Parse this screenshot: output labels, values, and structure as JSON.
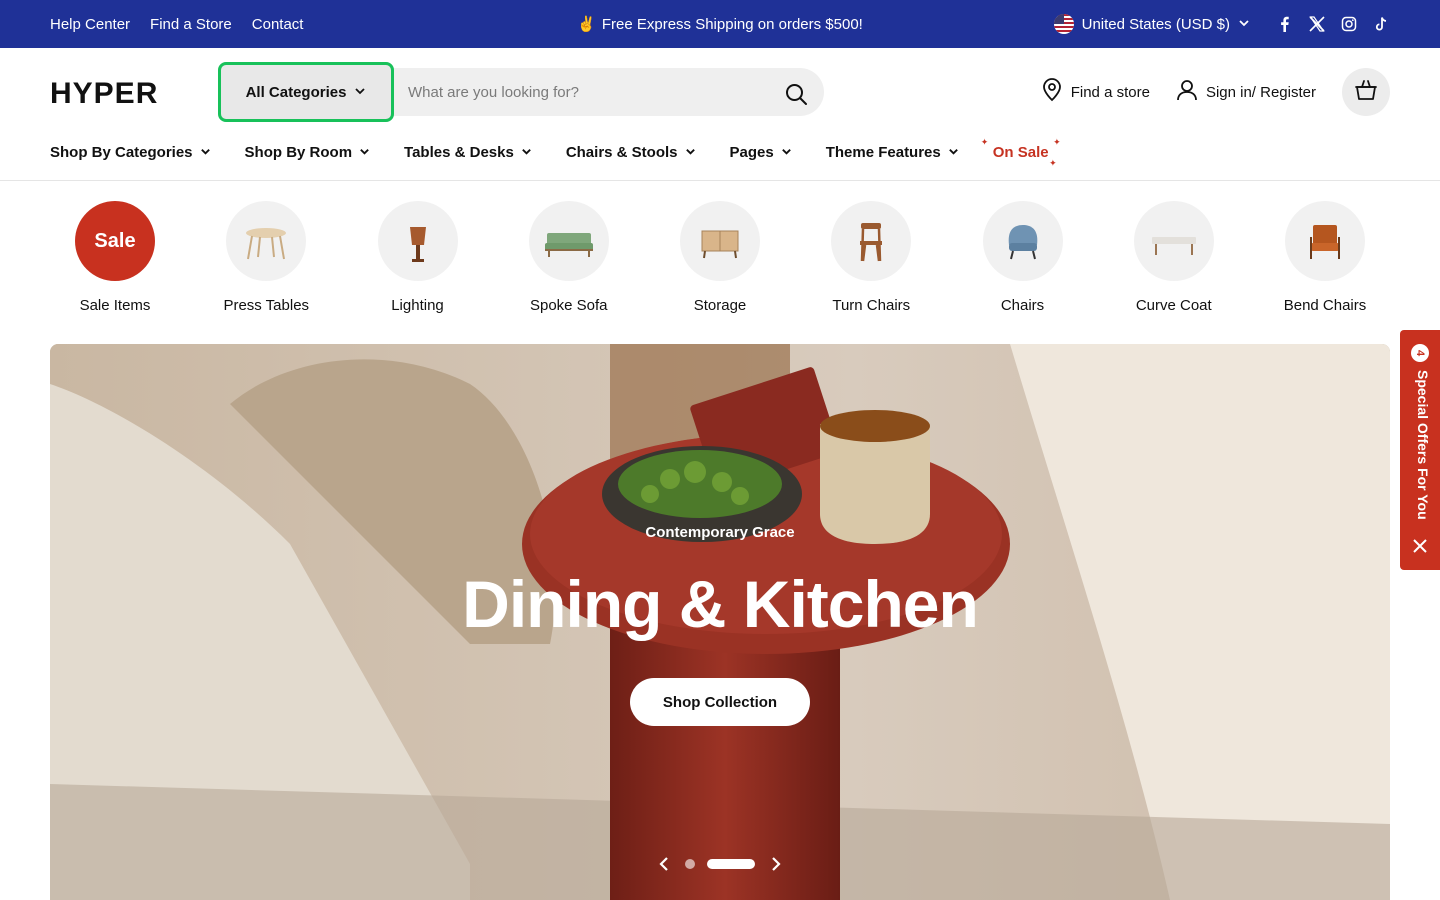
{
  "topbar": {
    "links": [
      "Help Center",
      "Find a Store",
      "Contact"
    ],
    "promo_emoji": "✌️",
    "promo_text": "Free Express Shipping on orders $500!",
    "currency": "United States (USD $)",
    "socials": [
      "facebook-icon",
      "x-icon",
      "instagram-icon",
      "tiktok-icon"
    ],
    "bg_color": "#1f3197"
  },
  "header": {
    "logo": "HYPER",
    "category_button": "All Categories",
    "search_placeholder": "What are you looking for?",
    "find_store": "Find a store",
    "sign_in": "Sign in/ Register"
  },
  "nav": {
    "items": [
      "Shop By Categories",
      "Shop By Room",
      "Tables & Desks",
      "Chairs & Stools",
      "Pages",
      "Theme Features"
    ],
    "sale_item": "On Sale",
    "sale_color": "#c63322"
  },
  "categories": [
    {
      "label": "Sale Items",
      "badge": "Sale"
    },
    {
      "label": "Press Tables"
    },
    {
      "label": "Lighting"
    },
    {
      "label": "Spoke Sofa"
    },
    {
      "label": "Storage"
    },
    {
      "label": "Turn Chairs"
    },
    {
      "label": "Chairs"
    },
    {
      "label": "Curve Coat"
    },
    {
      "label": "Bend Chairs"
    }
  ],
  "hero": {
    "subtitle": "Contemporary Grace",
    "title": "Dining & Kitchen",
    "button": "Shop Collection",
    "slides_count": 2,
    "active_slide": 2
  },
  "side_tab": {
    "count": "4",
    "label": "Special Offers For You",
    "color": "#c8311f"
  }
}
